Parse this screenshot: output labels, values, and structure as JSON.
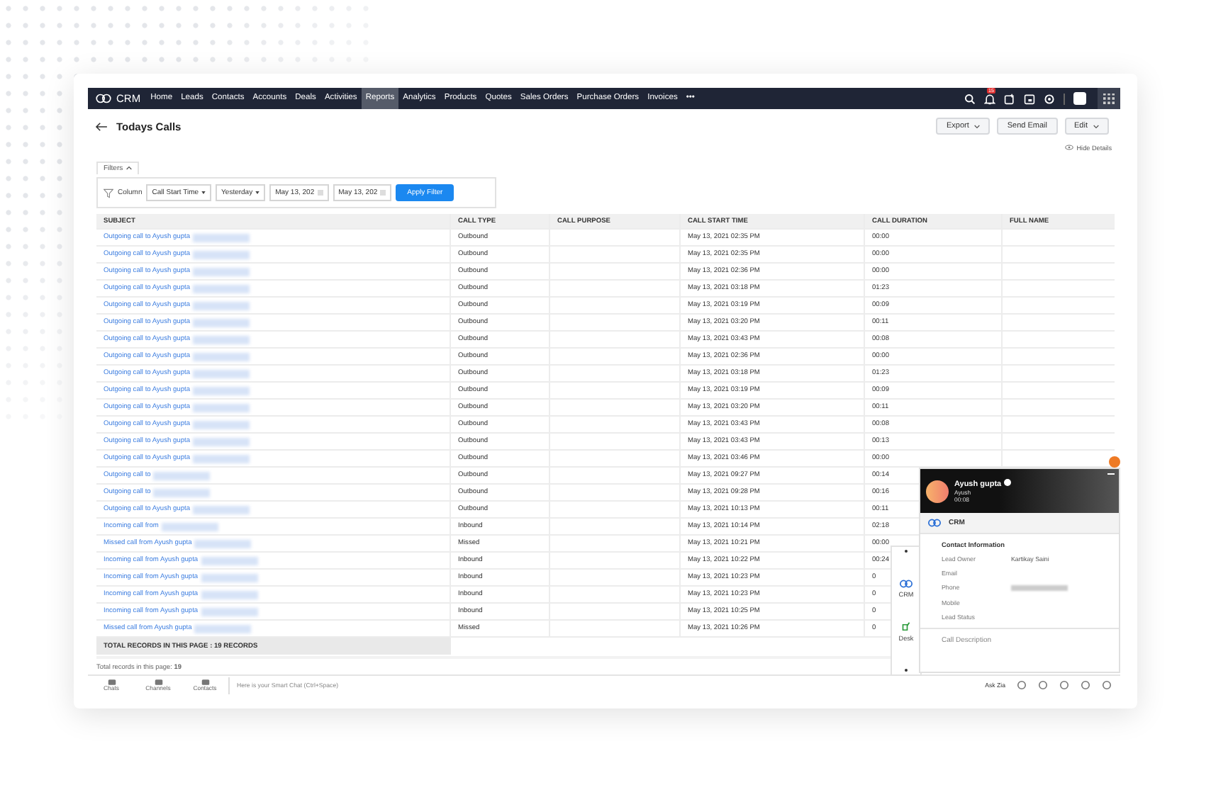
{
  "nav": {
    "logo": "CRM",
    "items": [
      {
        "label": "Home",
        "selected": false
      },
      {
        "label": "Leads",
        "selected": false
      },
      {
        "label": "Contacts",
        "selected": false
      },
      {
        "label": "Accounts",
        "selected": false
      },
      {
        "label": "Deals",
        "selected": false
      },
      {
        "label": "Activities",
        "selected": false
      },
      {
        "label": "Reports",
        "selected": true
      },
      {
        "label": "Analytics",
        "selected": false
      },
      {
        "label": "Products",
        "selected": false
      },
      {
        "label": "Quotes",
        "selected": false
      },
      {
        "label": "Sales Orders",
        "selected": false
      },
      {
        "label": "Purchase Orders",
        "selected": false
      },
      {
        "label": "Invoices",
        "selected": false
      }
    ],
    "more": "•••",
    "notification_count": "15"
  },
  "header": {
    "title": "Todays Calls",
    "buttons": [
      {
        "label": "Export",
        "dropdown": true
      },
      {
        "label": "Send Email",
        "dropdown": false
      },
      {
        "label": "Edit",
        "dropdown": true
      }
    ],
    "hide_details": "Hide Details"
  },
  "filters": {
    "tab": "Filters",
    "column_label": "Column",
    "field": "Call Start Time",
    "period": "Yesterday",
    "from": "May 13, 202",
    "to": "May 13, 202",
    "apply": "Apply Filter"
  },
  "table": {
    "columns": [
      "SUBJECT",
      "CALL TYPE",
      "CALL PURPOSE",
      "CALL START TIME",
      "CALL DURATION",
      "FULL NAME"
    ],
    "rows": [
      {
        "subject": "Outgoing call to Ayush gupta",
        "redacted": true,
        "call_type": "Outbound",
        "call_start_time": "May 13, 2021 02:35 PM",
        "call_duration": "00:00"
      },
      {
        "subject": "Outgoing call to Ayush gupta",
        "redacted": true,
        "call_type": "Outbound",
        "call_start_time": "May 13, 2021 02:35 PM",
        "call_duration": "00:00"
      },
      {
        "subject": "Outgoing call to Ayush gupta",
        "redacted": true,
        "call_type": "Outbound",
        "call_start_time": "May 13, 2021 02:36 PM",
        "call_duration": "00:00"
      },
      {
        "subject": "Outgoing call to Ayush gupta",
        "redacted": true,
        "call_type": "Outbound",
        "call_start_time": "May 13, 2021 03:18 PM",
        "call_duration": "01:23"
      },
      {
        "subject": "Outgoing call to Ayush gupta",
        "redacted": true,
        "call_type": "Outbound",
        "call_start_time": "May 13, 2021 03:19 PM",
        "call_duration": "00:09"
      },
      {
        "subject": "Outgoing call to Ayush gupta",
        "redacted": true,
        "call_type": "Outbound",
        "call_start_time": "May 13, 2021 03:20 PM",
        "call_duration": "00:11"
      },
      {
        "subject": "Outgoing call to Ayush gupta",
        "redacted": true,
        "call_type": "Outbound",
        "call_start_time": "May 13, 2021 03:43 PM",
        "call_duration": "00:08"
      },
      {
        "subject": "Outgoing call to Ayush gupta",
        "redacted": true,
        "call_type": "Outbound",
        "call_start_time": "May 13, 2021 02:36 PM",
        "call_duration": "00:00"
      },
      {
        "subject": "Outgoing call to Ayush gupta",
        "redacted": true,
        "call_type": "Outbound",
        "call_start_time": "May 13, 2021 03:18 PM",
        "call_duration": "01:23"
      },
      {
        "subject": "Outgoing call to Ayush gupta",
        "redacted": true,
        "call_type": "Outbound",
        "call_start_time": "May 13, 2021 03:19 PM",
        "call_duration": "00:09"
      },
      {
        "subject": "Outgoing call to Ayush gupta",
        "redacted": true,
        "call_type": "Outbound",
        "call_start_time": "May 13, 2021 03:20 PM",
        "call_duration": "00:11"
      },
      {
        "subject": "Outgoing call to Ayush gupta",
        "redacted": true,
        "call_type": "Outbound",
        "call_start_time": "May 13, 2021 03:43 PM",
        "call_duration": "00:08"
      },
      {
        "subject": "Outgoing call to Ayush gupta",
        "redacted": true,
        "call_type": "Outbound",
        "call_start_time": "May 13, 2021 03:43 PM",
        "call_duration": "00:13"
      },
      {
        "subject": "Outgoing call to Ayush gupta",
        "redacted": true,
        "call_type": "Outbound",
        "call_start_time": "May 13, 2021 03:46 PM",
        "call_duration": "00:00"
      },
      {
        "subject": "Outgoing call to",
        "redacted": true,
        "call_type": "Outbound",
        "call_start_time": "May 13, 2021 09:27 PM",
        "call_duration": "00:14"
      },
      {
        "subject": "Outgoing call to",
        "redacted": true,
        "call_type": "Outbound",
        "call_start_time": "May 13, 2021 09:28 PM",
        "call_duration": "00:16"
      },
      {
        "subject": "Outgoing call to Ayush gupta",
        "redacted": true,
        "call_type": "Outbound",
        "call_start_time": "May 13, 2021 10:13 PM",
        "call_duration": "00:11"
      },
      {
        "subject": "Incoming call from",
        "redacted": true,
        "call_type": "Inbound",
        "call_start_time": "May 13, 2021 10:14 PM",
        "call_duration": "02:18"
      },
      {
        "subject": "Missed call from Ayush gupta",
        "redacted": true,
        "call_type": "Missed",
        "call_start_time": "May 13, 2021 10:21 PM",
        "call_duration": "00:00"
      },
      {
        "subject": "Incoming call from Ayush gupta",
        "redacted": true,
        "call_type": "Inbound",
        "call_start_time": "May 13, 2021 10:22 PM",
        "call_duration": "00:24"
      },
      {
        "subject": "Incoming call from Ayush gupta",
        "redacted": true,
        "call_type": "Inbound",
        "call_start_time": "May 13, 2021 10:23 PM",
        "call_duration": "0"
      },
      {
        "subject": "Incoming call from Ayush gupta",
        "redacted": true,
        "call_type": "Inbound",
        "call_start_time": "May 13, 2021 10:23 PM",
        "call_duration": "0"
      },
      {
        "subject": "Incoming call from Ayush gupta",
        "redacted": true,
        "call_type": "Inbound",
        "call_start_time": "May 13, 2021 10:25 PM",
        "call_duration": "0"
      },
      {
        "subject": "Missed call from Ayush gupta",
        "redacted": true,
        "call_type": "Missed",
        "call_start_time": "May 13, 2021 10:26 PM",
        "call_duration": "0"
      }
    ],
    "total_row": "TOTAL RECORDS IN THIS PAGE : 19 RECORDS"
  },
  "summary": "Total records in this page: **19**",
  "bottom_bar": {
    "items": [
      "Chats",
      "Channels",
      "Contacts"
    ],
    "smart_chat_placeholder": "Here is your Smart Chat (Ctrl+Space)",
    "ask_zia": "Ask Zia"
  },
  "call_panel": {
    "name": "Ayush gupta",
    "subtitle": "Ayush",
    "timer": "00:08",
    "section": "CRM",
    "info_title": "Contact Information",
    "fields": [
      {
        "label": "Lead Owner",
        "value": "Kartikay Saini",
        "redacted": false
      },
      {
        "label": "Email",
        "redacted": false
      },
      {
        "label": "Phone",
        "redacted": true
      },
      {
        "label": "Mobile",
        "redacted": false
      },
      {
        "label": "Lead Status",
        "redacted": false
      }
    ],
    "description_placeholder": "Call Description",
    "apps": [
      {
        "label": "CRM",
        "kind": "crm"
      },
      {
        "label": "Desk",
        "kind": "desk"
      }
    ]
  }
}
